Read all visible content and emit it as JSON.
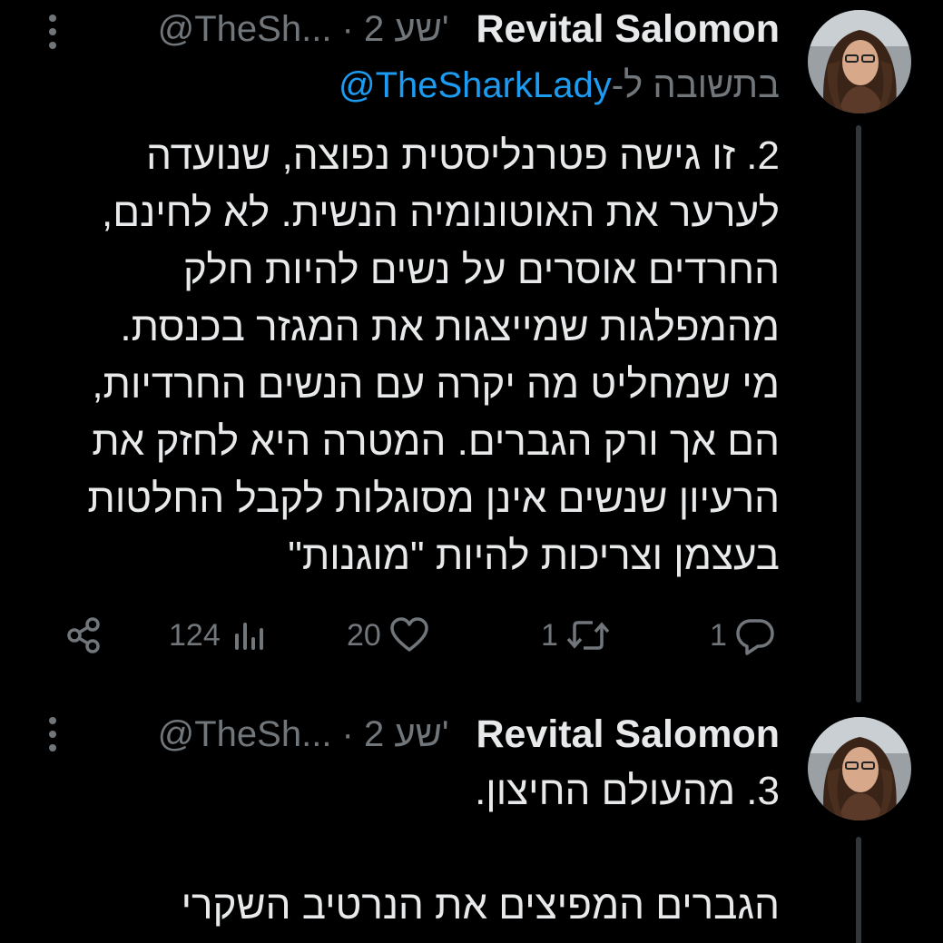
{
  "tweets": [
    {
      "author": "Revital Salomon",
      "meta": "@TheSh... · 2 שע'",
      "reply_prefix": "בתשובה ל-",
      "reply_mention": "@TheSharkLady",
      "text_lines": [
        "2. זו גישה פטרנליסטית נפוצה, שנועדה",
        "לערער את האוטונומיה הנשית. לא לחינם,",
        "החרדים אוסרים על נשים להיות חלק",
        "מהמפלגות שמייצגות את המגזר בכנסת.",
        "מי שמחליט מה יקרה עם הנשים החרדיות,",
        "הם אך ורק הגברים. המטרה היא לחזק את",
        "הרעיון שנשים אינן מסוגלות לקבל החלטות",
        "בעצמן וצריכות להיות \"מוגנות\""
      ],
      "stats": {
        "replies": "1",
        "reposts": "1",
        "likes": "20",
        "views": "124"
      }
    },
    {
      "author": "Revital Salomon",
      "meta": "@TheSh... · 2 שע'",
      "text_lines": [
        "3. מהעולם החיצון.",
        "",
        "הגברים המפיצים את הנרטיב השקרי"
      ]
    }
  ],
  "icons": {
    "reply": "reply-icon",
    "repost": "repost-icon",
    "like": "heart-icon",
    "views": "views-icon",
    "share": "share-icon",
    "more": "more-vertical-icon"
  },
  "colors": {
    "background": "#000000",
    "text": "#e7e9ea",
    "muted": "#71767b",
    "link": "#1d9bf0",
    "thread_line": "#333639"
  }
}
